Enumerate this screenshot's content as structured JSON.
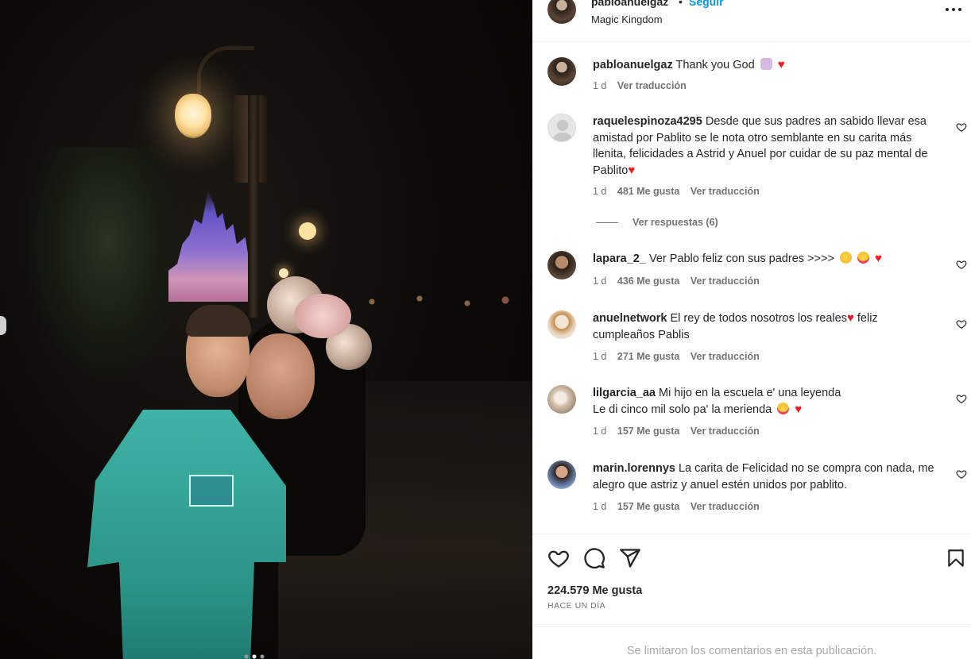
{
  "post": {
    "username": "pabloanuelgaz",
    "separator": "•",
    "follow_label": "Seguir",
    "location": "Magic Kingdom",
    "more_icon": "more-horizontal-icon"
  },
  "caption": {
    "username": "pabloanuelgaz",
    "text": "Thank you God",
    "emojis": [
      "praying-hands",
      "red-heart"
    ],
    "time": "1 d",
    "translate": "Ver traducción"
  },
  "comments": [
    {
      "username": "raquelespinoza4295",
      "text": "Desde que sus padres an sabido llevar esa amistad por Pablito se le nota otro semblante en su carita más llenita, felicidades a Astrid y Anuel por cuidar de su paz mental de Pablito",
      "emojis": [
        "red-heart"
      ],
      "time": "1 d",
      "likes": "481 Me gusta",
      "translate": "Ver traducción",
      "replies": "Ver respuestas (6)"
    },
    {
      "username": "lapara_2_",
      "text": "Ver Pablo feliz con sus padres >>>>",
      "emojis": [
        "grinning-squinting-face",
        "heart-eyes",
        "red-heart"
      ],
      "time": "1 d",
      "likes": "436 Me gusta",
      "translate": "Ver traducción"
    },
    {
      "username": "anuelnetwork",
      "text": "El rey de todos nosotros los reales",
      "text_after": "feliz cumpleaños Pablis",
      "emojis": [
        "red-heart"
      ],
      "time": "1 d",
      "likes": "271 Me gusta",
      "translate": "Ver traducción"
    },
    {
      "username": "lilgarcia_aa",
      "text": "Mi hijo en la escuela e' una leyenda",
      "text_line2": "Le di cinco mil solo pa' la merienda",
      "emojis": [
        "heart-eyes",
        "red-heart"
      ],
      "time": "1 d",
      "likes": "157 Me gusta",
      "translate": "Ver traducción"
    },
    {
      "username": "marin.lorennys",
      "text": "La carita de Felicidad no se compra con nada, me alegro que astriz y anuel estén unidos por pablito.",
      "time": "1 d",
      "likes": "157 Me gusta",
      "translate": "Ver traducción"
    }
  ],
  "footer": {
    "likes": "224.579 Me gusta",
    "date": "HACE UN DÍA",
    "limited_notice": "Se limitaron los comentarios en esta publicación."
  },
  "colors": {
    "follow_blue": "#0095f6",
    "heart_red": "#ed1c24",
    "muted_text": "#737373"
  }
}
